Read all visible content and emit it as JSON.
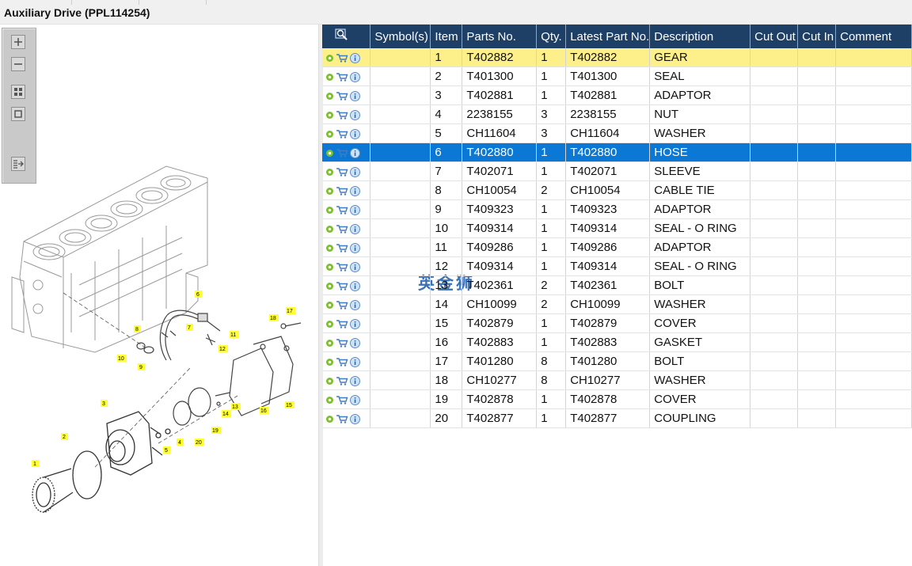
{
  "window": {
    "title": "Auxiliary Drive (PPL114254)"
  },
  "watermark": "英金狮",
  "toolbar": {
    "buttons": [
      {
        "name": "zoom-in-button",
        "icon": "plus-icon"
      },
      {
        "name": "zoom-out-button",
        "icon": "minus-icon"
      },
      {
        "name": "fit-all-button",
        "icon": "grid-icon"
      },
      {
        "name": "fit-window-button",
        "icon": "square-icon"
      },
      {
        "name": "list-arrow-button",
        "icon": "list-arrow-icon"
      }
    ]
  },
  "callouts": [
    "1",
    "2",
    "3",
    "4",
    "5",
    "6",
    "7",
    "8",
    "9",
    "10",
    "11",
    "12",
    "13",
    "14",
    "15",
    "16",
    "17",
    "18",
    "19",
    "20"
  ],
  "table": {
    "headers": {
      "icons": "",
      "symbols": "Symbol(s)",
      "item": "Item",
      "parts_no": "Parts No.",
      "qty": "Qty.",
      "latest_part_no": "Latest Part No.",
      "description": "Description",
      "cut_out": "Cut Out",
      "cut_in": "Cut In",
      "comment": "Comment"
    },
    "rows": [
      {
        "item": "1",
        "parts_no": "T402882",
        "qty": "1",
        "latest": "T402882",
        "description": "GEAR"
      },
      {
        "item": "2",
        "parts_no": "T401300",
        "qty": "1",
        "latest": "T401300",
        "description": "SEAL"
      },
      {
        "item": "3",
        "parts_no": "T402881",
        "qty": "1",
        "latest": "T402881",
        "description": "ADAPTOR"
      },
      {
        "item": "4",
        "parts_no": "2238155",
        "qty": "3",
        "latest": "2238155",
        "description": "NUT"
      },
      {
        "item": "5",
        "parts_no": "CH11604",
        "qty": "3",
        "latest": "CH11604",
        "description": "WASHER"
      },
      {
        "item": "6",
        "parts_no": "T402880",
        "qty": "1",
        "latest": "T402880",
        "description": "HOSE"
      },
      {
        "item": "7",
        "parts_no": "T402071",
        "qty": "1",
        "latest": "T402071",
        "description": "SLEEVE"
      },
      {
        "item": "8",
        "parts_no": "CH10054",
        "qty": "2",
        "latest": "CH10054",
        "description": "CABLE TIE"
      },
      {
        "item": "9",
        "parts_no": "T409323",
        "qty": "1",
        "latest": "T409323",
        "description": "ADAPTOR"
      },
      {
        "item": "10",
        "parts_no": "T409314",
        "qty": "1",
        "latest": "T409314",
        "description": "SEAL - O RING"
      },
      {
        "item": "11",
        "parts_no": "T409286",
        "qty": "1",
        "latest": "T409286",
        "description": "ADAPTOR"
      },
      {
        "item": "12",
        "parts_no": "T409314",
        "qty": "1",
        "latest": "T409314",
        "description": "SEAL - O RING"
      },
      {
        "item": "13",
        "parts_no": "T402361",
        "qty": "2",
        "latest": "T402361",
        "description": "BOLT"
      },
      {
        "item": "14",
        "parts_no": "CH10099",
        "qty": "2",
        "latest": "CH10099",
        "description": "WASHER"
      },
      {
        "item": "15",
        "parts_no": "T402879",
        "qty": "1",
        "latest": "T402879",
        "description": "COVER"
      },
      {
        "item": "16",
        "parts_no": "T402883",
        "qty": "1",
        "latest": "T402883",
        "description": "GASKET"
      },
      {
        "item": "17",
        "parts_no": "T401280",
        "qty": "8",
        "latest": "T401280",
        "description": "BOLT"
      },
      {
        "item": "18",
        "parts_no": "CH10277",
        "qty": "8",
        "latest": "CH10277",
        "description": "WASHER"
      },
      {
        "item": "19",
        "parts_no": "T402878",
        "qty": "1",
        "latest": "T402878",
        "description": "COVER"
      },
      {
        "item": "20",
        "parts_no": "T402877",
        "qty": "1",
        "latest": "T402877",
        "description": "COUPLING"
      }
    ],
    "highlight_yellow_row": 0,
    "highlight_blue_row": 5,
    "row_icons": [
      "gear-icon",
      "cart-icon",
      "info-icon"
    ],
    "colors": {
      "header": "#1e3f66",
      "yellow": "#fdf08a",
      "blue": "#0a78d4",
      "callout": "#ffff33"
    }
  }
}
